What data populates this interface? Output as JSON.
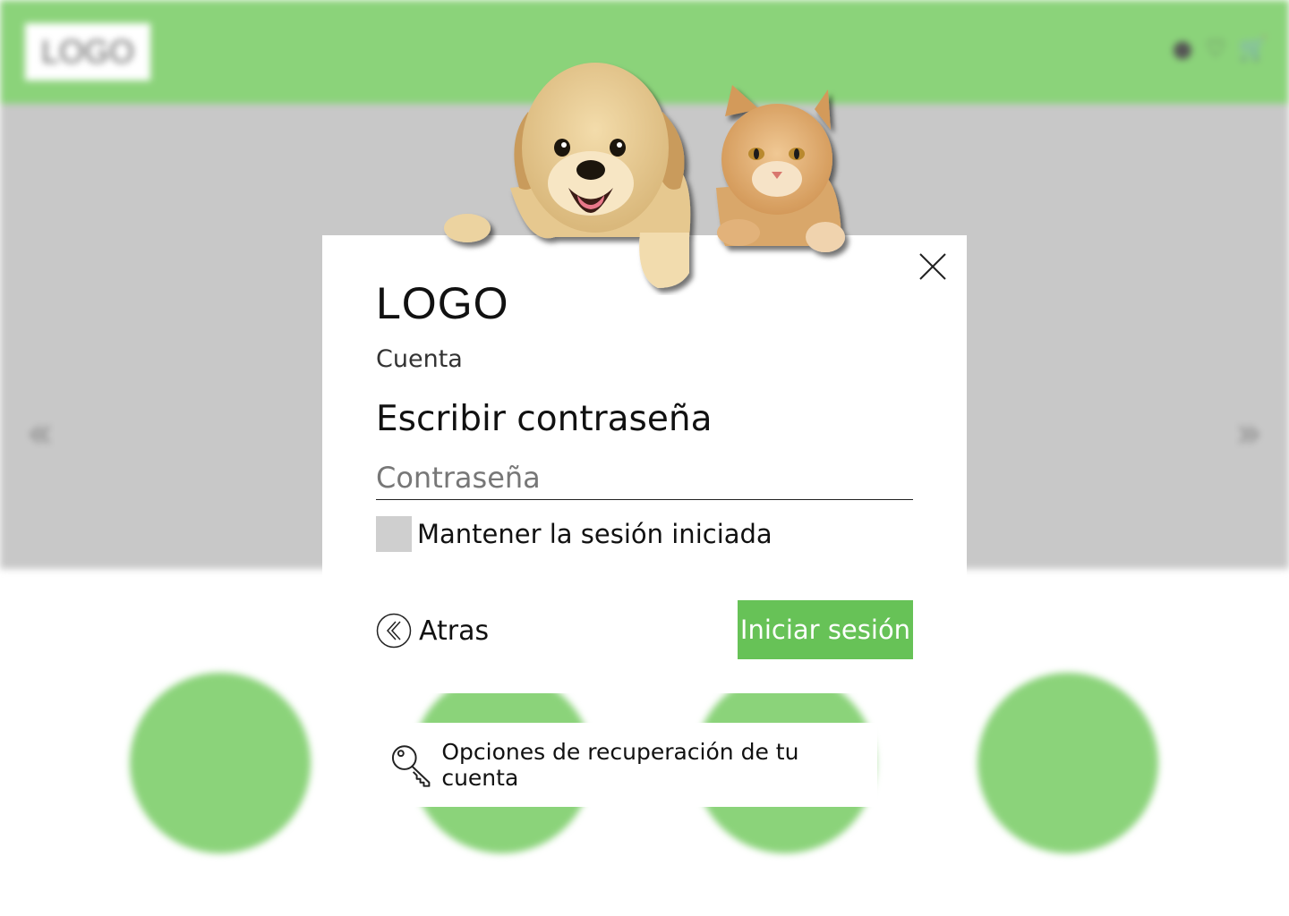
{
  "background": {
    "logo_text": "LOGO",
    "header_icons": [
      "user-icon",
      "heart-icon",
      "cart-icon"
    ],
    "left_arrow": "«",
    "right_arrow": "»",
    "circle_count": 4,
    "colors": {
      "header": "#8bd37a",
      "hero": "#c8c8c8"
    }
  },
  "modal": {
    "logo": "LOGO",
    "subtitle": "Cuenta",
    "title": "Escribir contraseña",
    "password_placeholder": "Contraseña",
    "keep_session_label": "Mantener la sesión iniciada",
    "keep_session_checked": false,
    "back_label": "Atras",
    "signin_label": "Iniciar sesión",
    "recovery_label": "Opciones de recuperación de tu cuenta",
    "colors": {
      "accent": "#67c257"
    }
  },
  "images": {
    "pets": "puppy and cat peeking over modal"
  }
}
